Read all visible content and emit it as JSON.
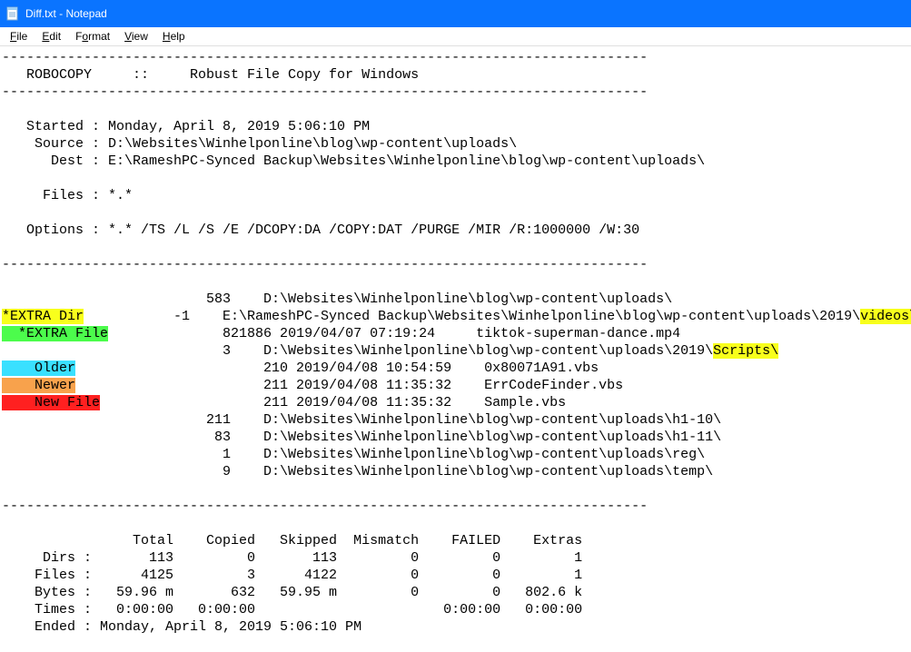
{
  "window": {
    "title": "Diff.txt - Notepad"
  },
  "menu": {
    "file": "File",
    "edit": "Edit",
    "format": "Format",
    "view": "View",
    "help": "Help"
  },
  "dash_full": "-------------------------------------------------------------------------------",
  "header_line": "   ROBOCOPY     ::     Robust File Copy for Windows",
  "info": {
    "started": "   Started : Monday, April 8, 2019 5:06:10 PM",
    "source": "    Source : D:\\Websites\\Winhelponline\\blog\\wp-content\\uploads\\",
    "dest": "      Dest : E:\\RameshPC-Synced Backup\\Websites\\Winhelponline\\blog\\wp-content\\uploads\\",
    "files": "     Files : *.*",
    "options": "   Options : *.* /TS /L /S /E /DCOPY:DA /COPY:DAT /PURGE /MIR /R:1000000 /W:30"
  },
  "rows": {
    "r583": {
      "pre": "                         583    D:\\Websites\\Winhelponline\\blog\\wp-content\\uploads\\"
    },
    "extra_dir": {
      "label": "*EXTRA Dir",
      "mid": "           -1    E:\\RameshPC-Synced Backup\\Websites\\Winhelponline\\blog\\wp-content\\uploads\\2019\\",
      "tail": "videos\\"
    },
    "extra_file": {
      "label": "  *EXTRA File",
      "rest": "              821886 2019/04/07 07:19:24     tiktok-superman-dance.mp4"
    },
    "r3": {
      "pre": "                           3    D:\\Websites\\Winhelponline\\blog\\wp-content\\uploads\\2019\\",
      "tail": "Scripts\\"
    },
    "older": {
      "label": "    Older",
      "rest": "                       210 2019/04/08 10:54:59    0x80071A91.vbs"
    },
    "newer": {
      "label": "    Newer",
      "rest": "                       211 2019/04/08 11:35:32    ErrCodeFinder.vbs"
    },
    "newfile": {
      "label": "    New File",
      "rest": "                    211 2019/04/08 11:35:32    Sample.vbs"
    },
    "r211": "                         211    D:\\Websites\\Winhelponline\\blog\\wp-content\\uploads\\h1-10\\",
    "r83": "                          83    D:\\Websites\\Winhelponline\\blog\\wp-content\\uploads\\h1-11\\",
    "r1": "                           1    D:\\Websites\\Winhelponline\\blog\\wp-content\\uploads\\reg\\",
    "r9": "                           9    D:\\Websites\\Winhelponline\\blog\\wp-content\\uploads\\temp\\"
  },
  "summary": {
    "header": "                Total    Copied   Skipped  Mismatch    FAILED    Extras",
    "dirs": "     Dirs :       113         0       113         0         0         1",
    "files": "    Files :      4125         3      4122         0         0         1",
    "bytes": "    Bytes :   59.96 m       632   59.95 m         0         0   802.6 k",
    "times": "    Times :   0:00:00   0:00:00                       0:00:00   0:00:00",
    "ended": "    Ended : Monday, April 8, 2019 5:06:10 PM"
  }
}
